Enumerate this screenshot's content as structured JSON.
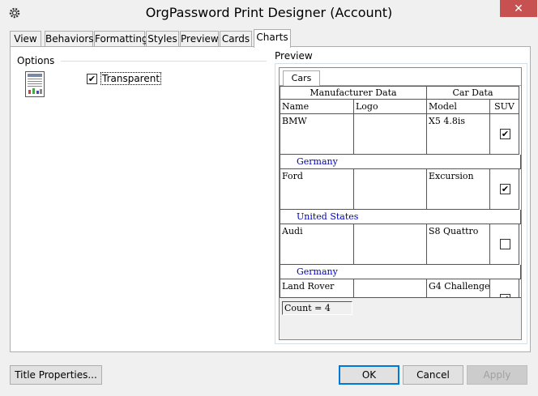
{
  "window": {
    "title": "OrgPassword Print Designer (Account)",
    "close_glyph": "✕"
  },
  "tabs": [
    {
      "label": "View"
    },
    {
      "label": "Behaviors"
    },
    {
      "label": "Formatting"
    },
    {
      "label": "Styles"
    },
    {
      "label": "Preview"
    },
    {
      "label": "Cards"
    },
    {
      "label": "Charts",
      "active": true
    }
  ],
  "options": {
    "label": "Options",
    "transparent": {
      "label": "Transparent",
      "checked": true
    }
  },
  "preview": {
    "label": "Preview",
    "sheet_tab": "Cars",
    "group_headers": [
      "Manufacturer Data",
      "Car Data"
    ],
    "columns": [
      "Name",
      "Logo",
      "Model",
      "SUV"
    ],
    "rows": [
      {
        "name": "BMW",
        "logo": "",
        "model": "X5 4.8is",
        "suv": true,
        "country": "Germany"
      },
      {
        "name": "Ford",
        "logo": "",
        "model": "Excursion",
        "suv": true,
        "country": "United States"
      },
      {
        "name": "Audi",
        "logo": "",
        "model": "S8 Quattro",
        "suv": false,
        "country": "Germany"
      },
      {
        "name": "Land Rover",
        "logo": "",
        "model": "G4 Challenge",
        "suv": true,
        "country": ""
      }
    ],
    "count_text": "Count = 4"
  },
  "buttons": {
    "title_properties": "Title Properties...",
    "ok": "OK",
    "cancel": "Cancel",
    "apply": "Apply"
  },
  "check_glyph": "✔"
}
